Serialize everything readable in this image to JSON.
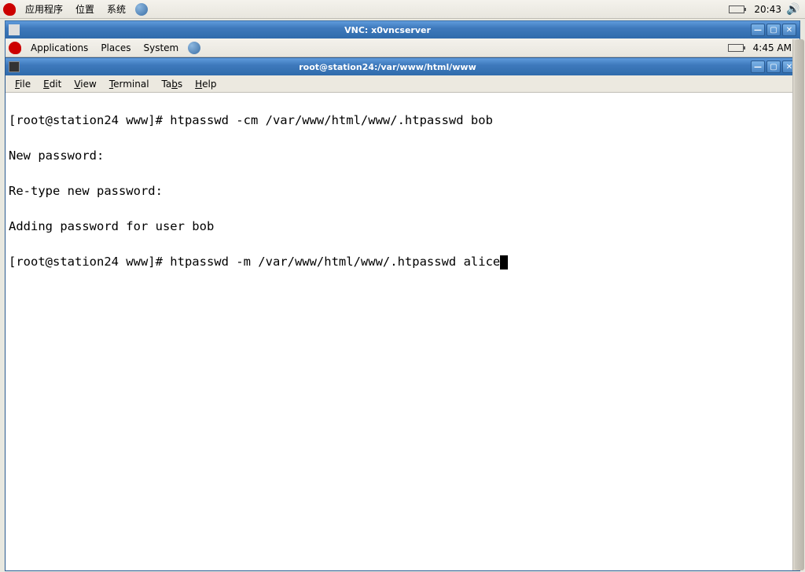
{
  "outer_panel": {
    "menus": [
      "应用程序",
      "位置",
      "系统"
    ],
    "clock": "20:43"
  },
  "vnc_window": {
    "title": "VNC: x0vncserver"
  },
  "inner_panel": {
    "menus": [
      "Applications",
      "Places",
      "System"
    ],
    "clock": "4:45 AM"
  },
  "terminal_window": {
    "title": "root@station24:/var/www/html/www",
    "menubar": [
      {
        "ul": "F",
        "rest": "ile"
      },
      {
        "ul": "E",
        "rest": "dit"
      },
      {
        "ul": "V",
        "rest": "iew"
      },
      {
        "ul": "T",
        "rest": "erminal"
      },
      {
        "ul": "",
        "rest": "Ta",
        "ul2": "b",
        "rest2": "s"
      },
      {
        "ul": "H",
        "rest": "elp"
      }
    ],
    "lines": [
      "[root@station24 www]# htpasswd -cm /var/www/html/www/.htpasswd bob",
      "New password: ",
      "Re-type new password: ",
      "Adding password for user bob",
      "[root@station24 www]# htpasswd -m /var/www/html/www/.htpasswd alice"
    ]
  }
}
